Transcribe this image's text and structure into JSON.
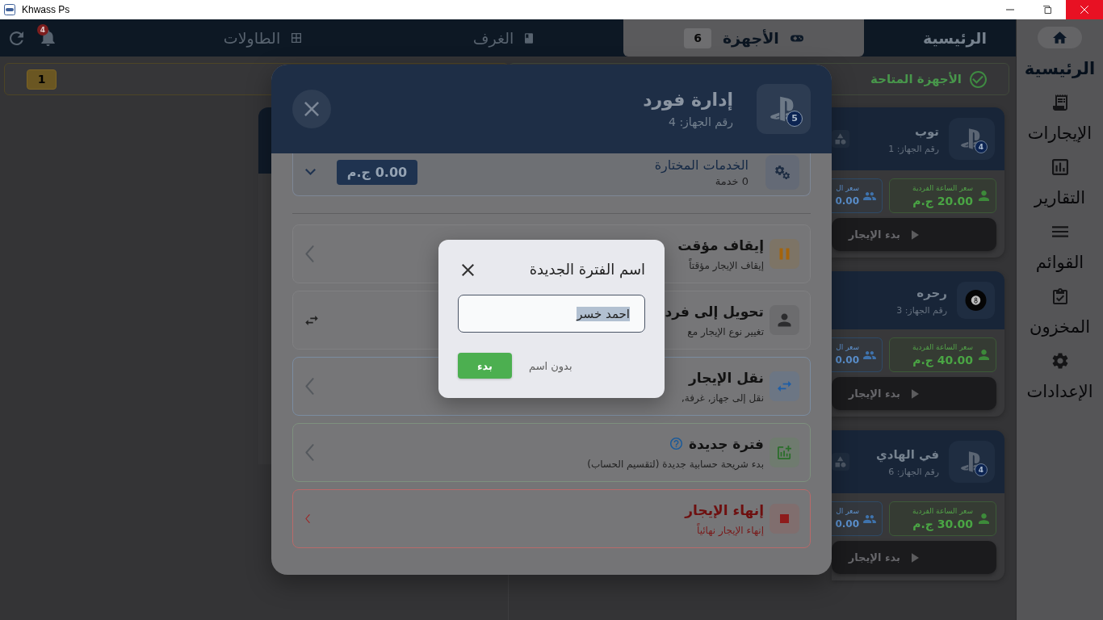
{
  "window": {
    "title": "Khwass Ps"
  },
  "sidebar": {
    "items": [
      {
        "label": "الرئيسية",
        "selected": true
      },
      {
        "label": "الإيجارات",
        "selected": false
      },
      {
        "label": "التقارير",
        "selected": false
      },
      {
        "label": "القوائم",
        "selected": false
      },
      {
        "label": "المخزون",
        "selected": false
      },
      {
        "label": "الإعدادات",
        "selected": false
      }
    ]
  },
  "top_nav": {
    "title": "الرئيسية",
    "tabs": [
      {
        "label": "الأجهزة",
        "count": "6",
        "selected": true
      },
      {
        "label": "الغرف",
        "selected": false
      },
      {
        "label": "الطاولات",
        "selected": false
      }
    ],
    "notification_count": "4"
  },
  "available_devices": {
    "title": "الأجهزة المتاحة",
    "devices": [
      {
        "kind": "console",
        "name": "توب",
        "number": "رقم الجهاز: 1",
        "badge": "4",
        "single_rate_label": "سعر الساعة الفردية",
        "single_rate": "20.00 ج.م",
        "multi_rate_label": "سعر ال",
        "multi_rate": "0.00",
        "start_label": "بدء الإيجار"
      },
      {
        "kind": "pool",
        "name": "رحره",
        "number": "رقم الجهاز: 3",
        "single_rate_label": "سعر الساعة الفردية",
        "single_rate": "40.00 ج.م",
        "multi_rate_label": "سعر ال",
        "multi_rate": "0.00",
        "start_label": "بدء الإيجار"
      },
      {
        "kind": "console",
        "name": "في الهادي",
        "number": "رقم الجهاز: 6",
        "badge": "4",
        "single_rate_label": "سعر الساعة الفردية",
        "single_rate": "30.00 ج.م",
        "multi_rate_label": "سعر ال",
        "multi_rate": "0.00",
        "start_label": "بدء الإيجار"
      }
    ]
  },
  "busy_devices": {
    "count": "1"
  },
  "device_modal": {
    "title": "إدارة فورد",
    "subtitle": "رقم الجهاز: 4",
    "badge": "5",
    "services": {
      "title": "الخدمات المختارة",
      "count": "0 خدمة",
      "total": "0.00 ج.م",
      "expanded": false
    },
    "actions": [
      {
        "kind": "pause",
        "title": "إيقاف مؤقت",
        "subtitle": "إيقاف الإيجار مؤقتاً",
        "help": false
      },
      {
        "kind": "convert",
        "title": "تحويل إلى فرد",
        "subtitle": "تغيير نوع الإيجار مع",
        "help": false
      },
      {
        "kind": "transfer",
        "title": "نقل الإيجار",
        "subtitle": "نقل إلى جهاز, غرفة,",
        "help": false
      },
      {
        "kind": "split",
        "title": "فترة جديدة",
        "subtitle": "بدء شريحة حسابية جديدة (لتقسيم الحساب)",
        "help": true
      },
      {
        "kind": "end",
        "title": "إنهاء الإيجار",
        "subtitle": "إنهاء الإيجار نهائياً",
        "help": false
      }
    ]
  },
  "rename_dialog": {
    "title": "اسم الفترة الجديدة",
    "value": "احمد خسر",
    "text_selected": true,
    "buttons": [
      {
        "label": "بدون اسم",
        "kind": "text"
      },
      {
        "label": "بدء",
        "kind": "primary"
      }
    ]
  }
}
